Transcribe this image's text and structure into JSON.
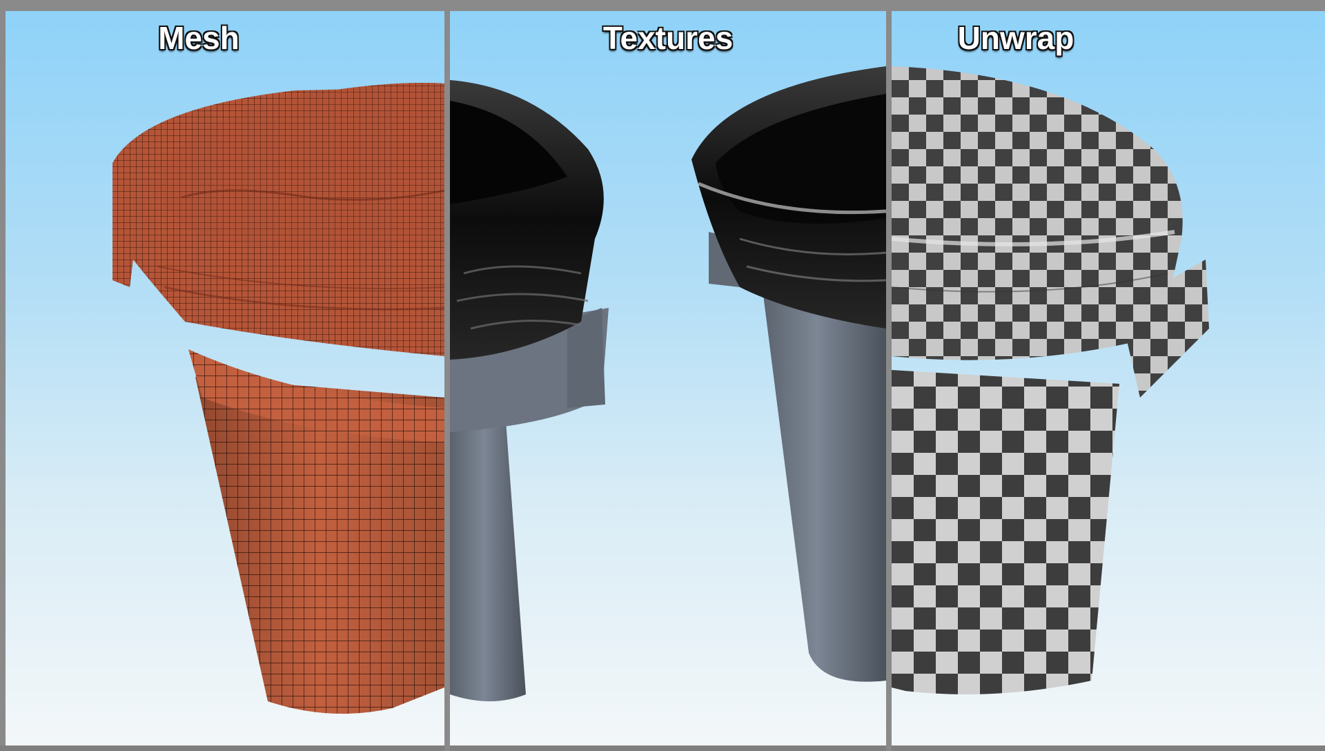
{
  "panels": [
    {
      "title": "Mesh"
    },
    {
      "title": "Textures"
    },
    {
      "title": "Unwrap"
    }
  ]
}
